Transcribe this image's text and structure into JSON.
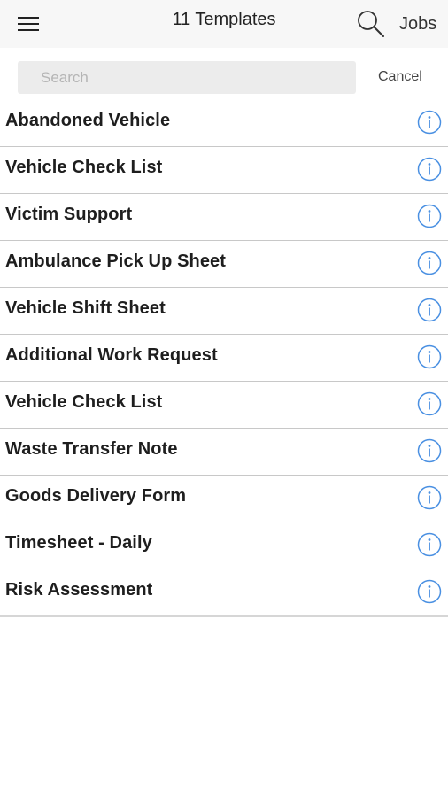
{
  "header": {
    "menu_icon": "hamburger-menu-icon",
    "title": "11 Templates",
    "search_icon": "magnifier-search-icon",
    "jobs_label": "Jobs"
  },
  "search": {
    "placeholder": "Search",
    "value": "",
    "cancel_label": "Cancel"
  },
  "templates": [
    {
      "name": "Abandoned Vehicle"
    },
    {
      "name": "Vehicle Check List"
    },
    {
      "name": "Victim Support"
    },
    {
      "name": "Ambulance Pick Up Sheet"
    },
    {
      "name": "Vehicle Shift Sheet"
    },
    {
      "name": "Additional Work Request"
    },
    {
      "name": "Vehicle Check List"
    },
    {
      "name": "Waste Transfer Note"
    },
    {
      "name": "Goods Delivery Form"
    },
    {
      "name": "Timesheet - Daily"
    },
    {
      "name": "Risk Assessment"
    }
  ],
  "row_icon": "info-icon",
  "colors": {
    "header_bg": "#f7f7f7",
    "search_field_bg": "#ececec",
    "info_icon": "#4a90e2",
    "divider": "#c8c8c8"
  }
}
